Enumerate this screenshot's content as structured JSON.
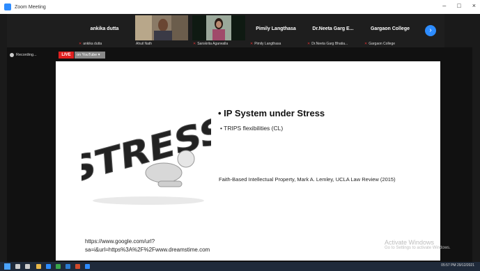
{
  "window": {
    "title": "Zoom Meeting",
    "controls": [
      "–",
      "□",
      "×"
    ]
  },
  "participants": [
    {
      "name": "ankika dutta",
      "label": "ankika dutta",
      "muted": true,
      "video": false
    },
    {
      "name": "",
      "label": "Ahuil Nath",
      "muted": false,
      "video": true
    },
    {
      "name": "",
      "label": "Sanskrita Agarwalla",
      "muted": true,
      "video": true
    },
    {
      "name": "Pimily Langthasa",
      "label": "Pimily Langthasa",
      "muted": true,
      "video": false
    },
    {
      "name": "Dr.Neeta Garg E...",
      "label": "Dr.Neeta Garg Bhatia...",
      "muted": true,
      "video": false
    },
    {
      "name": "Gargaon College",
      "label": "Gargaon College",
      "muted": true,
      "video": false
    }
  ],
  "recording": {
    "label": "Recording..."
  },
  "live": {
    "badge": "LIVE",
    "platform": "on YouTube ▾"
  },
  "slide": {
    "image_text": "STRESS",
    "bullet1": "• IP System under Stress",
    "bullet2": "• TRIPS flexibilities (CL)",
    "citation": "Faith-Based Intellectual Property, Mark A. Lemley, UCLA Law Review (2015)",
    "url": "https://www.google.com/url?sa=i&url=https%3A%2F%2Fwww.dreamstime.com"
  },
  "watermark": {
    "line1": "Activate Windows",
    "line2": "Go to Settings to activate Windows."
  },
  "taskbar": {
    "time": "05:57 PM",
    "date": "29/12/2021"
  },
  "colors": {
    "accent": "#2d8cff",
    "live": "#e02020"
  }
}
